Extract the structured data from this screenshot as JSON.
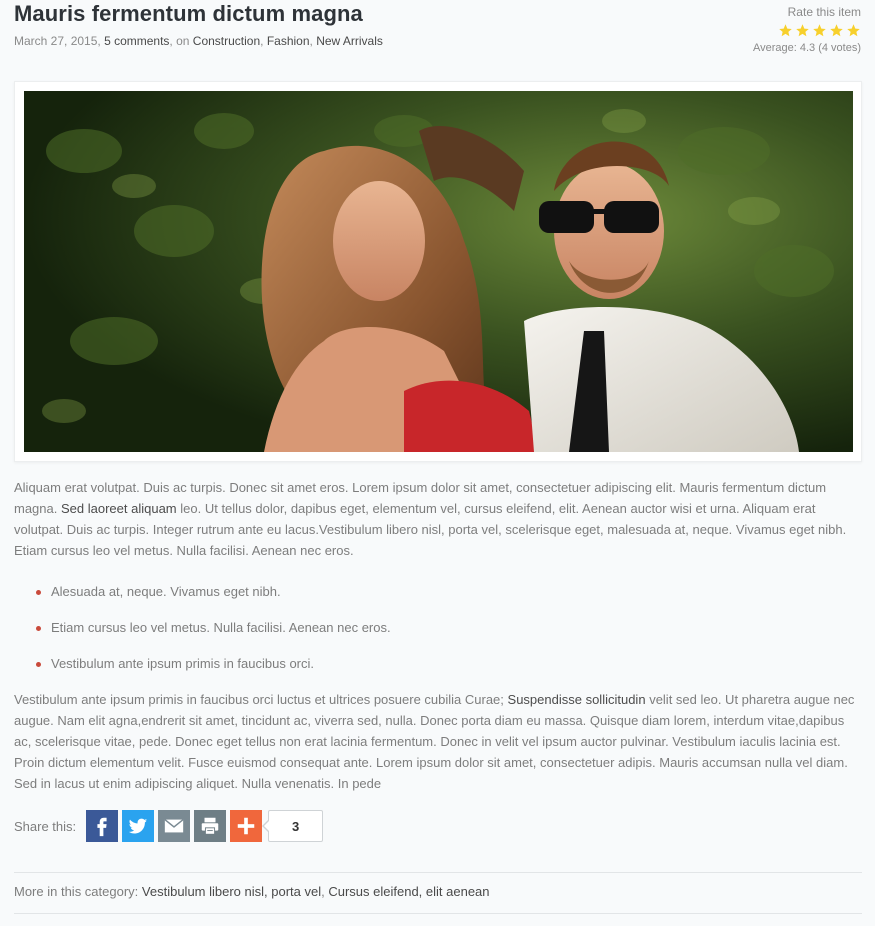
{
  "article": {
    "title": "Mauris fermentum dictum magna",
    "date": "March 27, 2015,",
    "comments": "5 comments",
    "on_label": ", on",
    "categories": [
      "Construction",
      "Fashion",
      "New Arrivals"
    ],
    "image_alt": "Couple photo"
  },
  "rating": {
    "label": "Rate this item",
    "stars": 5,
    "filled": 5,
    "star_color": "#f7d02c",
    "average": "Average: 4.3 (4 votes)"
  },
  "body": {
    "p1_a": "Aliquam erat volutpat. Duis ac turpis. Donec sit amet eros. Lorem ipsum dolor sit amet, consectetuer adipiscing elit. Mauris fermentum dictum magna.",
    "p1_strong": "Sed laoreet aliquam",
    "p1_b": "leo. Ut tellus dolor, dapibus eget, elementum vel, cursus eleifend, elit. Aenean auctor wisi et urna. Aliquam erat volutpat. Duis ac turpis. Integer rutrum ante eu lacus.Vestibulum libero nisl, porta vel, scelerisque eget, malesuada at, neque. Vivamus eget nibh. Etiam cursus leo vel metus. Nulla facilisi. Aenean nec eros.",
    "bullets": [
      "Alesuada at, neque. Vivamus eget nibh.",
      "Etiam cursus leo vel metus. Nulla facilisi. Aenean nec eros.",
      "Vestibulum ante ipsum primis in faucibus orci."
    ],
    "p2_a": "Vestibulum ante ipsum primis in faucibus orci luctus et ultrices posuere cubilia Curae;",
    "p2_strong": "Suspendisse sollicitudin",
    "p2_b": "velit sed leo. Ut pharetra augue nec augue. Nam elit agna,endrerit sit amet, tincidunt ac, viverra sed, nulla. Donec porta diam eu massa. Quisque diam lorem, interdum vitae,dapibus ac, scelerisque vitae, pede. Donec eget tellus non erat lacinia fermentum. Donec in velit vel ipsum auctor pulvinar. Vestibulum iaculis lacinia est. Proin dictum elementum velit. Fusce euismod consequat ante. Lorem ipsum dolor sit amet, consectetuer adipis. Mauris accumsan nulla vel diam. Sed in lacus ut enim adipiscing aliquet. Nulla venenatis. In pede"
  },
  "share": {
    "label": "Share this:",
    "buttons": [
      {
        "icon": "facebook-icon",
        "color": "#3b5998"
      },
      {
        "icon": "twitter-icon",
        "color": "#2aa3ef"
      },
      {
        "icon": "email-icon",
        "color": "#7a8a93"
      },
      {
        "icon": "print-icon",
        "color": "#6e7e85"
      },
      {
        "icon": "plus-icon",
        "color": "#f0673c"
      }
    ],
    "count": "3"
  },
  "more": {
    "label": "More in this category:",
    "link1": "Vestibulum libero nisl, porta vel",
    "sep": ",",
    "link2": "Cursus eleifend, elit aenean"
  }
}
